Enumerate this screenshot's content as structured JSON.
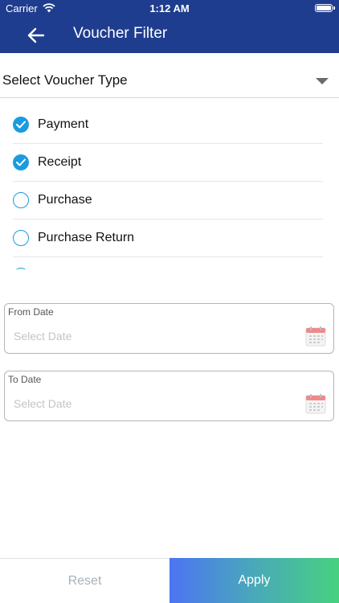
{
  "status_bar": {
    "carrier": "Carrier",
    "time": "1:12 AM",
    "wifi_icon": "wifi-icon",
    "battery_icon": "battery-icon"
  },
  "header": {
    "title": "Voucher Filter",
    "back_icon": "arrow-left-icon",
    "background_color": "#1f3d8f"
  },
  "voucher_select": {
    "label": "Select Voucher Type",
    "dropdown_icon": "caret-down-icon"
  },
  "voucher_types": [
    {
      "label": "Payment",
      "checked": true
    },
    {
      "label": "Receipt",
      "checked": true
    },
    {
      "label": "Purchase",
      "checked": false
    },
    {
      "label": "Purchase Return",
      "checked": false
    },
    {
      "label": "",
      "checked": false
    }
  ],
  "from_date": {
    "caption": "From Date",
    "placeholder": "Select Date",
    "icon": "calendar-icon"
  },
  "to_date": {
    "caption": "To Date",
    "placeholder": "Select Date",
    "icon": "calendar-icon"
  },
  "actions": {
    "reset_label": "Reset",
    "apply_label": "Apply"
  },
  "colors": {
    "accent": "#1a9be0",
    "apply_gradient_start": "#4c74f4",
    "apply_gradient_end": "#47d17f"
  }
}
